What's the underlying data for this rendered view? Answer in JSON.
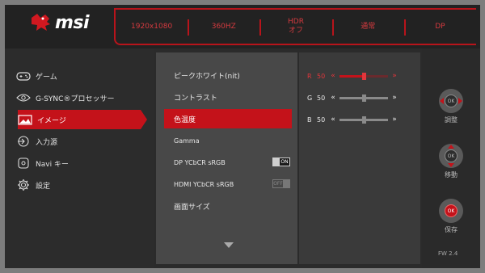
{
  "brand": {
    "name": "msi",
    "logo_icon": "msi-dragon-icon"
  },
  "status_bar": [
    {
      "line1": "1920x1080",
      "line2": ""
    },
    {
      "line1": "360HZ",
      "line2": ""
    },
    {
      "line1": "HDR",
      "line2": "オフ"
    },
    {
      "line1": "通常",
      "line2": ""
    },
    {
      "line1": "DP",
      "line2": ""
    }
  ],
  "left_menu": [
    {
      "label": "ゲーム",
      "icon": "gamepad-icon",
      "active": false
    },
    {
      "label": "G-SYNC®プロセッサー",
      "icon": "gsync-icon",
      "active": false
    },
    {
      "label": "イメージ",
      "icon": "image-icon",
      "active": true
    },
    {
      "label": "入力源",
      "icon": "input-source-icon",
      "active": false
    },
    {
      "label": "Navi キー",
      "icon": "joystick-icon",
      "active": false
    },
    {
      "label": "設定",
      "icon": "gear-icon",
      "active": false
    }
  ],
  "sub_menu": [
    {
      "label": "ピークホワイト(nit)",
      "active": false
    },
    {
      "label": "コントラスト",
      "active": false
    },
    {
      "label": "色温度",
      "active": true
    },
    {
      "label": "Gamma",
      "active": false
    },
    {
      "label": "DP YCbCR sRGB",
      "toggle": "ON"
    },
    {
      "label": "HDMI YCbCR sRGB",
      "toggle": "OFF"
    },
    {
      "label": "画面サイズ",
      "active": false
    }
  ],
  "color_temp": [
    {
      "channel": "R",
      "value": "50",
      "fraction": 0.5,
      "selected": true
    },
    {
      "channel": "G",
      "value": "50",
      "fraction": 0.5,
      "selected": false
    },
    {
      "channel": "B",
      "value": "50",
      "fraction": 0.5,
      "selected": false
    }
  ],
  "arrows": {
    "left": "«",
    "right": "»"
  },
  "joystick": [
    {
      "label": "調整",
      "center": "OK",
      "directions": "left-right"
    },
    {
      "label": "移動",
      "center": "OK",
      "directions": "up-down"
    },
    {
      "label": "保存",
      "center": "OK",
      "directions": "press"
    }
  ],
  "firmware": "FW  2.4",
  "colors": {
    "accent": "#c4121a",
    "status_text": "#d43a3f"
  }
}
